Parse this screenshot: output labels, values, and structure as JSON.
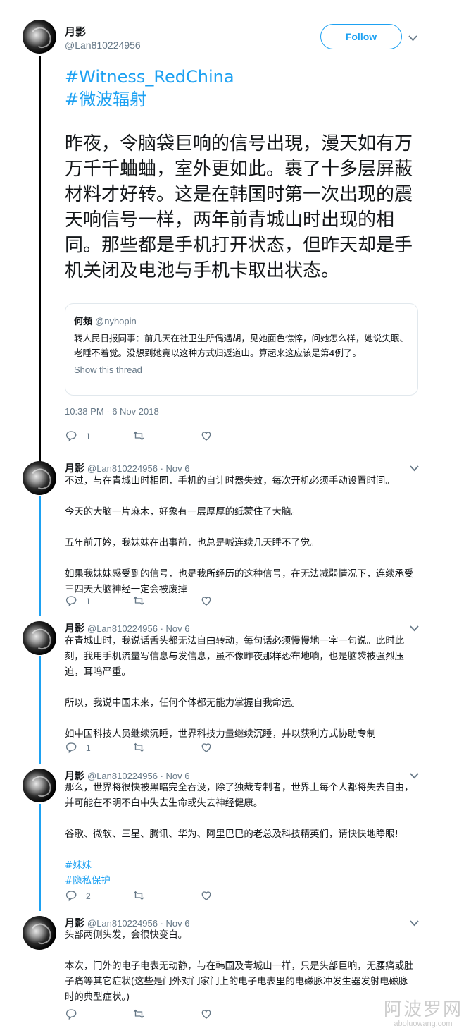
{
  "main": {
    "name": "月影",
    "handle": "@Lan810224956",
    "follow_label": "Follow",
    "hashtags": [
      "#Witness_RedChina",
      "#微波辐射"
    ],
    "text": "昨夜，令脑袋巨响的信号出現，漫天如有万万千千蛐蛐，室外更如此。裹了十多层屏蔽材料才好转。这是在韩国时第一次出现的震天响信号一样，两年前青城山时出现的相同。那些都是手机打开状态，但昨天却是手机关闭及电池与手机卡取出状态。",
    "quote": {
      "name": "何頻",
      "handle": "@nyhopin",
      "text": "转人民日报同事：前几天在社卫生所偶遇胡，见她面色憔悴，问她怎么样，她说失眠、老睡不着觉。没想到她竟以这种方式归返道山。算起来这应该是第4例了。",
      "link": "Show this thread"
    },
    "timestamp": "10:38 PM - 6 Nov 2018",
    "reply_count": "1",
    "retweet_count": "",
    "like_count": ""
  },
  "replies": [
    {
      "name": "月影",
      "meta": "@Lan810224956 · Nov 6",
      "paragraphs": [
        "不过，与在青城山时相同，手机的自计时器失效，每次开机必须手动设置时间。",
        "今天的大脑一片麻木，好象有一层厚厚的纸蒙住了大脑。",
        "五年前开妗，我妹妹在出事前，也总是喊连续几天睡不了觉。",
        "如果我妹妹感受到的信号，也是我所经历的这种信号，在无法减弱情况下，连续承受三四天大脑神经一定会被废掉"
      ],
      "reply_count": "1"
    },
    {
      "name": "月影",
      "meta": "@Lan810224956 · Nov 6",
      "paragraphs": [
        "在青城山时，我说话舌头都无法自由转动，每句话必须慢慢地一字一句说。此时此刻，我用手机流量写信息与发信息，虽不像昨夜那样恐布地响，也是脑袋被强烈压迫，耳鸣严重。",
        "所以，我说中国未来，任何个体都无能力掌握自我命运。",
        "如中国科技人员继续沉睡，世界科技力量继续沉睡，并以获利方式协助专制"
      ],
      "reply_count": "1"
    },
    {
      "name": "月影",
      "meta": "@Lan810224956 · Nov 6",
      "paragraphs": [
        "那么，世界将很快被黑暗完全吞没，除了独裁专制者，世界上每个人都将失去自由，并可能在不明不白中失去生命或失去神经健康。",
        "谷歌、微软、三星、腾讯、华为、阿里巴巴的老总及科技精英们，请快快地睁眼!"
      ],
      "tags": [
        "#妹妹",
        "#隐私保护"
      ],
      "reply_count": "2"
    },
    {
      "name": "月影",
      "meta": "@Lan810224956 · Nov 6",
      "paragraphs": [
        "头部两侧头发，会很快变白。",
        "本次，门外的电子电表无动静，与在韩国及青城山一样，只是头部巨响，无腰痛或肚子痛等其它症状(这些是门外对门家门上的电子电表里的电磁脉冲发生器发射电磁脉时的典型症状。)"
      ],
      "reply_count": ""
    }
  ],
  "watermark": {
    "big": "阿波罗网",
    "small": "aboluowang.com"
  },
  "colors": {
    "accent": "#1da1f2",
    "muted": "#657786",
    "text": "#14171a",
    "border": "#e1e8ed"
  }
}
